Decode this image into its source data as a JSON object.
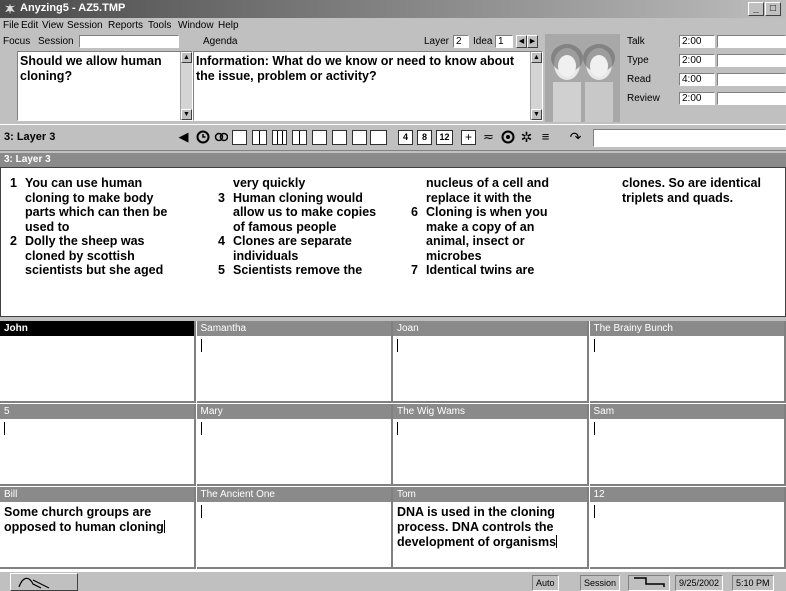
{
  "window": {
    "title": "Anyzing5 - AZ5.TMP",
    "controls": [
      "_",
      "□"
    ]
  },
  "menu": [
    "File",
    "Edit",
    "View",
    "Session",
    "Reports",
    "Tools",
    "Window",
    "Help"
  ],
  "focus": {
    "label": "Focus",
    "session_label": "Session",
    "text": "Should we allow human cloning?"
  },
  "agenda": {
    "label": "Agenda",
    "layer_label": "Layer",
    "layer_value": "2",
    "idea_label": "Idea",
    "idea_value": "1",
    "text": "Information: What do we know or need to know about the issue, problem or activity?"
  },
  "timers": [
    {
      "label": "Talk",
      "value": "2:00"
    },
    {
      "label": "Type",
      "value": "2:00"
    },
    {
      "label": "Read",
      "value": "4:00"
    },
    {
      "label": "Review",
      "value": "2:00"
    }
  ],
  "toolbar": {
    "layer_label": "3: Layer 3",
    "icons": [
      "back-arrow-icon",
      "clock-icon",
      "shuffle-icon",
      "single-box-icon",
      "two-column-icon",
      "three-column-icon",
      "four-column-icon",
      "five-column-icon",
      "six-column-icon",
      "seven-column-icon",
      "eight-column-icon"
    ],
    "num_buttons": [
      "4",
      "8",
      "12"
    ],
    "combo_value": ""
  },
  "layer_panel": {
    "title": "3: Layer 3",
    "columns": [
      [
        {
          "num": "1",
          "lines": [
            "You can use human",
            "cloning to make body",
            "parts which can then be",
            "used to"
          ]
        },
        {
          "num": "2",
          "lines": [
            "Dolly the sheep was",
            "cloned by scottish",
            "scientists but she aged"
          ]
        }
      ],
      [
        {
          "num": "",
          "lines": [
            "very quickly"
          ]
        },
        {
          "num": "3",
          "lines": [
            "Human cloning would",
            "allow us to make copies",
            "of famous people"
          ]
        },
        {
          "num": "4",
          "lines": [
            "Clones are separate",
            "individuals"
          ]
        },
        {
          "num": "5",
          "lines": [
            "Scientists remove the"
          ]
        }
      ],
      [
        {
          "num": "",
          "lines": [
            "nucleus of a cell and",
            "replace it with the"
          ]
        },
        {
          "num": "6",
          "lines": [
            "Cloning is when you",
            "make a copy of an",
            "animal, insect or",
            "microbes"
          ]
        },
        {
          "num": "7",
          "lines": [
            "Identical twins are"
          ]
        }
      ],
      [
        {
          "num": "",
          "lines": [
            "clones. So are identical",
            "triplets and quads."
          ]
        }
      ]
    ]
  },
  "participants": [
    {
      "name": "John",
      "text": "",
      "active": true,
      "caret": false
    },
    {
      "name": "Samantha",
      "text": "",
      "active": false,
      "caret": true
    },
    {
      "name": "Joan",
      "text": "",
      "active": false,
      "caret": true
    },
    {
      "name": "The Brainy Bunch",
      "text": "",
      "active": false,
      "caret": true
    },
    {
      "name": "5",
      "text": "",
      "active": false,
      "caret": true
    },
    {
      "name": "Mary",
      "text": "",
      "active": false,
      "caret": true
    },
    {
      "name": "The Wig Wams",
      "text": "",
      "active": false,
      "caret": true
    },
    {
      "name": "Sam",
      "text": "",
      "active": false,
      "caret": true
    },
    {
      "name": "Bill",
      "text": "Some church groups are opposed to human cloning",
      "active": false,
      "caret": true
    },
    {
      "name": "The Ancient One",
      "text": "",
      "active": false,
      "caret": true
    },
    {
      "name": "Tom",
      "text": "DNA is used in the cloning process. DNA controls the development of organisms",
      "active": false,
      "caret": true
    },
    {
      "name": "12",
      "text": "",
      "active": false,
      "caret": true
    }
  ],
  "statusbar": {
    "auto": "Auto",
    "session": "Session",
    "date": "9/25/2002",
    "time": "5:10 PM"
  },
  "colors": {
    "face": "#c0c0c0",
    "header": "#8a8a8a",
    "active_header": "#000000"
  }
}
